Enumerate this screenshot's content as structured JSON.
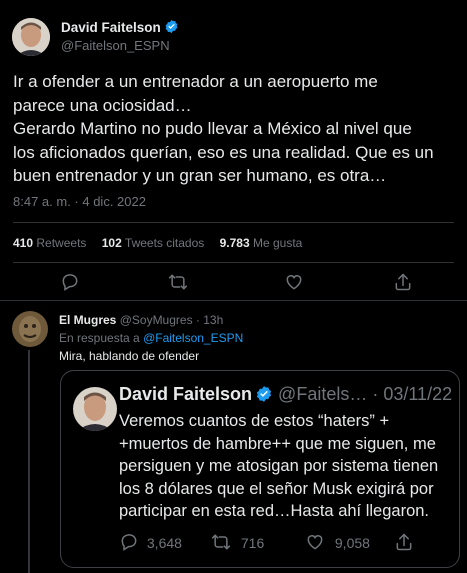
{
  "main_tweet": {
    "author_name": "David Faitelson",
    "author_handle": "@Faitelson_ESPN",
    "text_lines": [
      "Ir a ofender a un entrenador a un aeropuerto me",
      "parece una ociosidad…",
      "Gerardo Martino no pudo llevar a México al nivel que",
      "los aficionados querían, eso es una realidad. Que es un",
      "buen entrenador y un gran ser humano, es otra…"
    ],
    "timestamp": "8:47 a. m. · 4 dic. 2022",
    "stats": {
      "retweets_count": "410",
      "retweets_label": "Retweets",
      "quotes_count": "102",
      "quotes_label": "Tweets citados",
      "likes_count": "9.783",
      "likes_label": "Me gusta"
    }
  },
  "reply": {
    "author_name": "El Mugres",
    "author_handle": "@SoyMugres",
    "time": "· 13h",
    "reply_prefix": "En respuesta a",
    "reply_to": "@Faitelson_ESPN",
    "text": "Mira, hablando de ofender"
  },
  "quoted_tweet": {
    "author_name": "David Faitelson",
    "author_handle": "@Faitels…",
    "date": "· 03/11/22",
    "text_lines": [
      "Veremos cuantos de estos “haters” +",
      "+muertos de hambre++ que me siguen, me",
      "persiguen y me atosigan por sistema tienen",
      "los 8 dólares que el señor Musk exigirá por",
      "participar en esta red…Hasta ahí llegaron."
    ],
    "replies_count": "3,648",
    "retweets_count": "716",
    "likes_count": "9,058"
  },
  "colors": {
    "background": "#000000",
    "text": "#e7e9ea",
    "muted": "#71767b",
    "accent": "#1d9bf0",
    "divider": "#2f3336"
  },
  "icons": [
    "verified-badge-icon",
    "reply-icon",
    "retweet-icon",
    "like-icon",
    "share-icon"
  ]
}
